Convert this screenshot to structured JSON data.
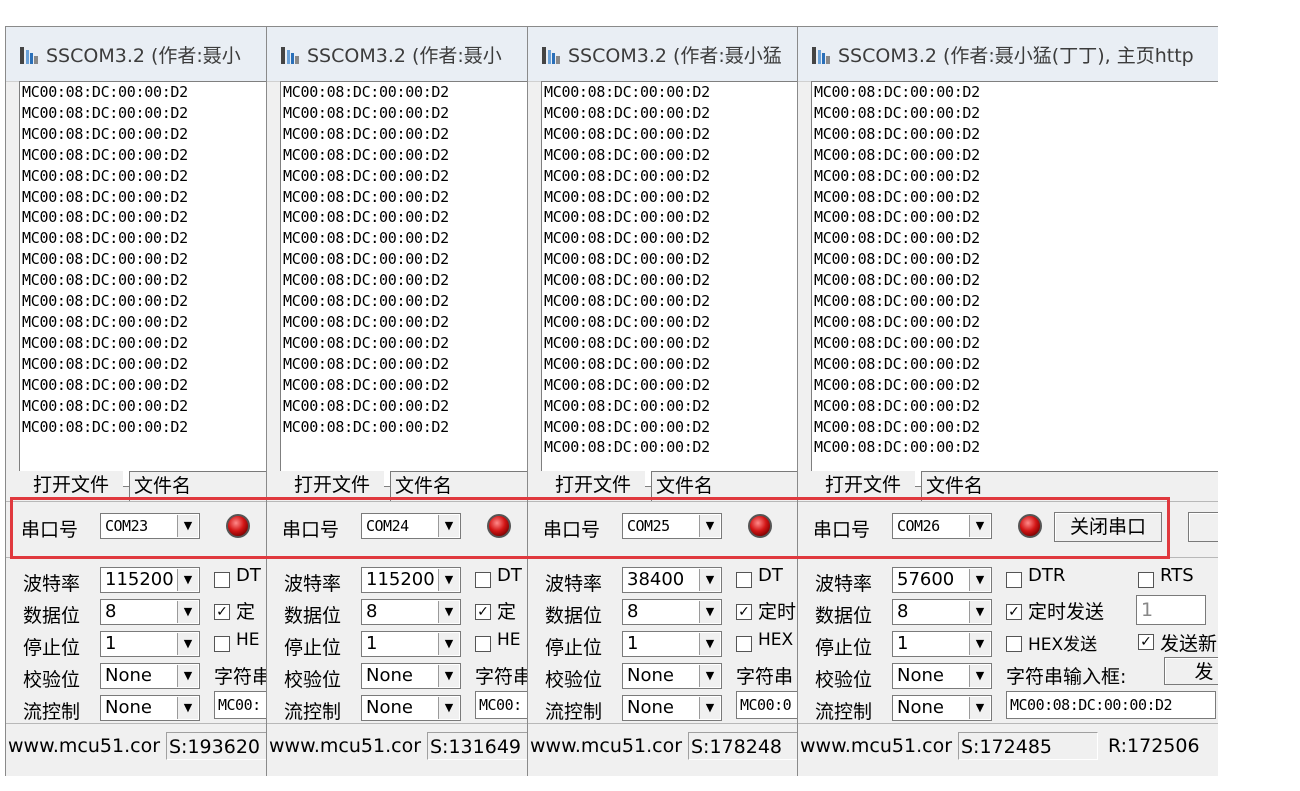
{
  "windows": [
    {
      "title": "SSCOM3.2 (作者:聂小",
      "recv_lines": [
        "MC00:08:DC:00:00:D2",
        "MC00:08:DC:00:00:D2",
        "MC00:08:DC:00:00:D2",
        "MC00:08:DC:00:00:D2",
        "MC00:08:DC:00:00:D2",
        "MC00:08:DC:00:00:D2",
        "MC00:08:DC:00:00:D2",
        "MC00:08:DC:00:00:D2",
        "MC00:08:DC:00:00:D2",
        "MC00:08:DC:00:00:D2",
        "MC00:08:DC:00:00:D2",
        "MC00:08:DC:00:00:D2",
        "MC00:08:DC:00:00:D2",
        "MC00:08:DC:00:00:D2",
        "MC00:08:DC:00:00:D2",
        "MC00:08:DC:00:00:D2",
        "MC00:08:DC:00:00:D2"
      ],
      "open_file": "打开文件",
      "file_name": "文件名",
      "port_label": "串口号",
      "port": "COM23",
      "baud_label": "波特率",
      "baud": "115200",
      "databits_label": "数据位",
      "databits": "8",
      "stopbits_label": "停止位",
      "stopbits": "1",
      "parity_label": "校验位",
      "parity": "None",
      "flow_label": "流控制",
      "flow": "None",
      "dtr": "DT",
      "timed": "定",
      "hex": "HE",
      "strlabel": "字符串",
      "strinput": "MC00:",
      "status_web": "www.mcu51.cor",
      "status_s": "S:193620"
    },
    {
      "title": "SSCOM3.2 (作者:聂小",
      "recv_lines": [
        "MC00:08:DC:00:00:D2",
        "MC00:08:DC:00:00:D2",
        "MC00:08:DC:00:00:D2",
        "MC00:08:DC:00:00:D2",
        "MC00:08:DC:00:00:D2",
        "MC00:08:DC:00:00:D2",
        "MC00:08:DC:00:00:D2",
        "MC00:08:DC:00:00:D2",
        "MC00:08:DC:00:00:D2",
        "MC00:08:DC:00:00:D2",
        "MC00:08:DC:00:00:D2",
        "MC00:08:DC:00:00:D2",
        "MC00:08:DC:00:00:D2",
        "MC00:08:DC:00:00:D2",
        "MC00:08:DC:00:00:D2",
        "MC00:08:DC:00:00:D2",
        "MC00:08:DC:00:00:D2"
      ],
      "open_file": "打开文件",
      "file_name": "文件名",
      "port_label": "串口号",
      "port": "COM24",
      "baud_label": "波特率",
      "baud": "115200",
      "databits_label": "数据位",
      "databits": "8",
      "stopbits_label": "停止位",
      "stopbits": "1",
      "parity_label": "校验位",
      "parity": "None",
      "flow_label": "流控制",
      "flow": "None",
      "dtr": "DT",
      "timed": "定",
      "hex": "HE",
      "strlabel": "字符串",
      "strinput": "MC00:",
      "status_web": "www.mcu51.cor",
      "status_s": "S:131649"
    },
    {
      "title": "SSCOM3.2 (作者:聂小猛",
      "recv_lines": [
        "MC00:08:DC:00:00:D2",
        "MC00:08:DC:00:00:D2",
        "MC00:08:DC:00:00:D2",
        "MC00:08:DC:00:00:D2",
        "MC00:08:DC:00:00:D2",
        "MC00:08:DC:00:00:D2",
        "MC00:08:DC:00:00:D2",
        "MC00:08:DC:00:00:D2",
        "MC00:08:DC:00:00:D2",
        "MC00:08:DC:00:00:D2",
        "MC00:08:DC:00:00:D2",
        "MC00:08:DC:00:00:D2",
        "MC00:08:DC:00:00:D2",
        "MC00:08:DC:00:00:D2",
        "MC00:08:DC:00:00:D2",
        "MC00:08:DC:00:00:D2",
        "MC00:08:DC:00:00:D2",
        "MC00:08:DC:00:00:D2"
      ],
      "open_file": "打开文件",
      "file_name": "文件名",
      "port_label": "串口号",
      "port": "COM25",
      "baud_label": "波特率",
      "baud": "38400",
      "databits_label": "数据位",
      "databits": "8",
      "stopbits_label": "停止位",
      "stopbits": "1",
      "parity_label": "校验位",
      "parity": "None",
      "flow_label": "流控制",
      "flow": "None",
      "dtr": "DT",
      "timed": "定时",
      "hex": "HEX",
      "strlabel": "字符串",
      "strinput": "MC00:0",
      "status_web": "www.mcu51.cor",
      "status_s": "S:178248"
    },
    {
      "title": "SSCOM3.2 (作者:聂小猛(丁丁), 主页http",
      "recv_lines": [
        "MC00:08:DC:00:00:D2",
        "MC00:08:DC:00:00:D2",
        "MC00:08:DC:00:00:D2",
        "MC00:08:DC:00:00:D2",
        "MC00:08:DC:00:00:D2",
        "MC00:08:DC:00:00:D2",
        "MC00:08:DC:00:00:D2",
        "MC00:08:DC:00:00:D2",
        "MC00:08:DC:00:00:D2",
        "MC00:08:DC:00:00:D2",
        "MC00:08:DC:00:00:D2",
        "MC00:08:DC:00:00:D2",
        "MC00:08:DC:00:00:D2",
        "MC00:08:DC:00:00:D2",
        "MC00:08:DC:00:00:D2",
        "MC00:08:DC:00:00:D2",
        "MC00:08:DC:00:00:D2",
        "MC00:08:DC:00:00:D2"
      ],
      "open_file": "打开文件",
      "file_name": "文件名",
      "port_label": "串口号",
      "port": "COM26",
      "close_port": "关闭串口",
      "baud_label": "波特率",
      "baud": "57600",
      "databits_label": "数据位",
      "databits": "8",
      "stopbits_label": "停止位",
      "stopbits": "1",
      "parity_label": "校验位",
      "parity": "None",
      "flow_label": "流控制",
      "flow": "None",
      "dtr": "DTR",
      "rts": "RTS",
      "timed": "定时发送",
      "interval": "1",
      "hex": "HEX发送",
      "send_newline": "发送新",
      "strlabel": "字符串输入框:",
      "send_btn": "发",
      "strinput": "MC00:08:DC:00:00:D2",
      "status_web": "www.mcu51.cor",
      "status_s": "S:172485",
      "status_r": "R:172506"
    }
  ],
  "colors": {
    "highlight": "#e0393e",
    "led": "#d21515"
  }
}
